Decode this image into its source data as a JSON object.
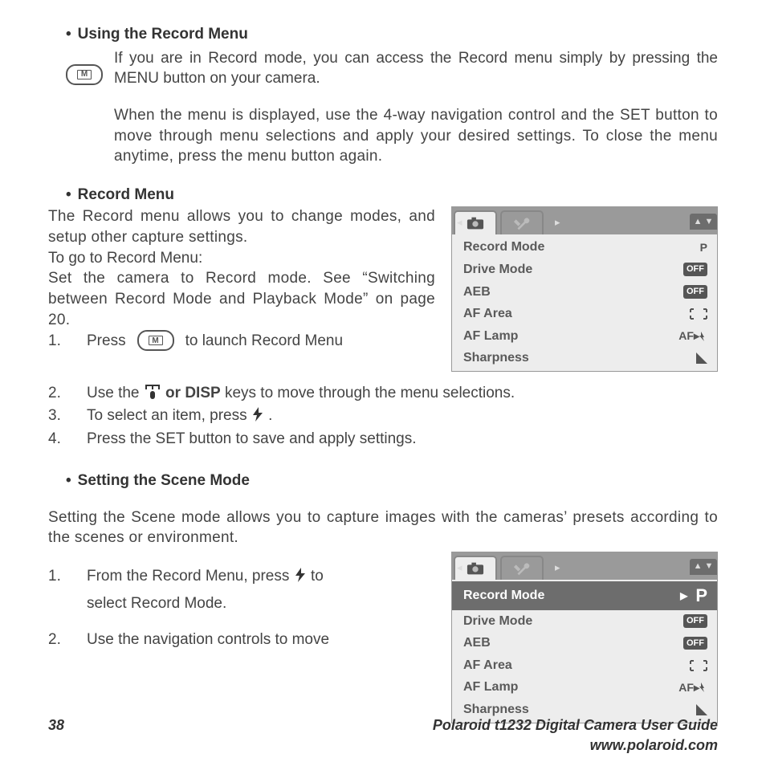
{
  "section1": {
    "heading": "Using the Record Menu",
    "p1": "If you are in Record mode, you can access the Record menu simply by pressing the MENU button on your camera.",
    "p2": "When the menu is displayed, use the 4-way navigation control and the SET button to move through menu selections and apply your desired settings. To close the menu anytime, press the menu button again."
  },
  "section2": {
    "heading": "Record Menu",
    "p1": "The Record menu allows you to change modes, and setup other capture settings.",
    "p2": "To go to Record Menu:",
    "p3": "Set the camera to Record mode. See “Switching between Record Mode and Playback Mode” on page 20.",
    "step1_a": "1.",
    "step1_b": "Press ",
    "step1_c": " to launch Record Menu",
    "step2_a": "2.",
    "step2_b": "Use the ",
    "step2_disp": " or DISP",
    "step2_c": " keys to move through the menu selections.",
    "step3_a": "3.",
    "step3_b": "To select an item, press ",
    "step3_c": " .",
    "step4_a": "4.",
    "step4_b": "Press the SET button to save and apply settings."
  },
  "section3": {
    "heading": "Setting the Scene Mode",
    "p1": "Setting the Scene mode allows you to capture images with the cameras’ presets according to the scenes or environment.",
    "step1_a": "1.",
    "step1_b": "From the Record Menu, press ",
    "step1_c": " to",
    "step1_d": "select Record Mode.",
    "step2_a": "2.",
    "step2_b": "Use the navigation controls to move"
  },
  "menu": {
    "rows": [
      {
        "label": "Record Mode",
        "value": "P",
        "type": "p"
      },
      {
        "label": "Drive Mode",
        "value": "OFF",
        "type": "off"
      },
      {
        "label": "AEB",
        "value": "OFF",
        "type": "off"
      },
      {
        "label": "AF Area",
        "value": "",
        "type": "afarea"
      },
      {
        "label": "AF Lamp",
        "value": "AF",
        "type": "aflamp"
      },
      {
        "label": "Sharpness",
        "value": "",
        "type": "sharp"
      }
    ]
  },
  "footer": {
    "page": "38",
    "title": "Polaroid t1232 Digital Camera User Guide",
    "url": "www.polaroid.com"
  }
}
